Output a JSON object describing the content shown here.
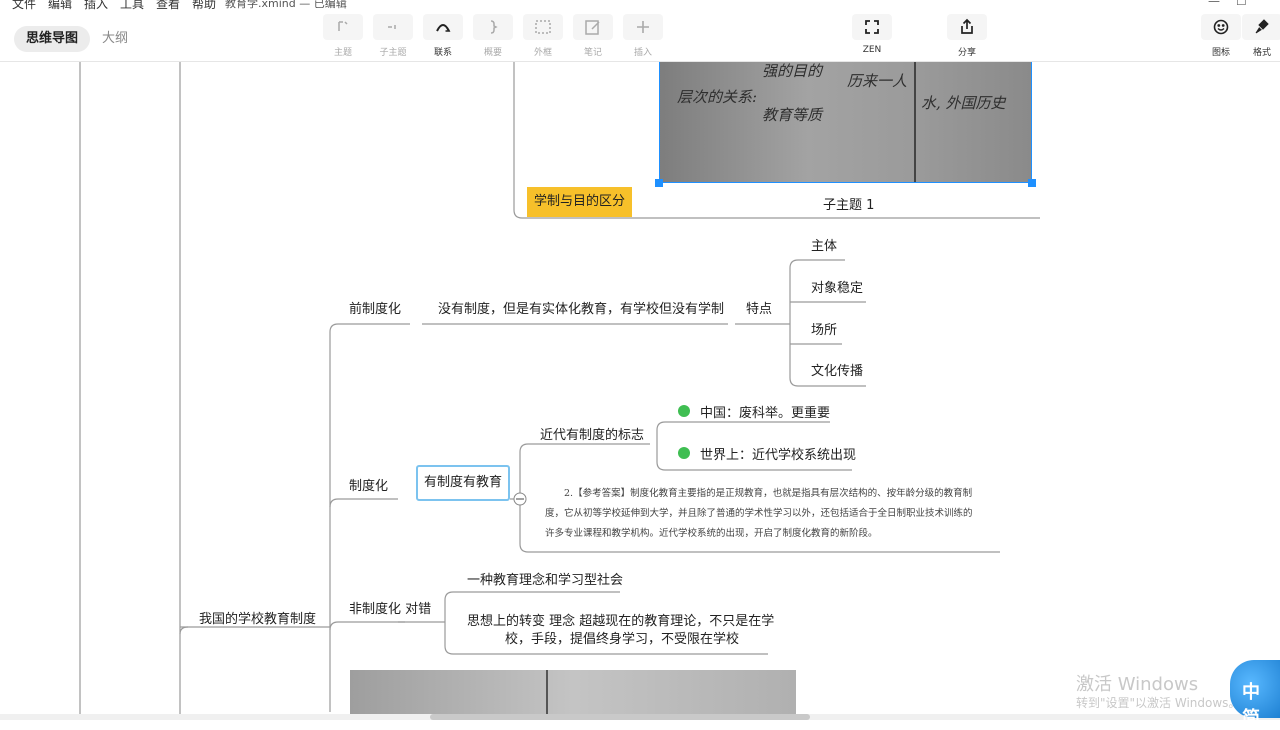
{
  "menu": [
    "文件",
    "编辑",
    "插入",
    "工具",
    "查看",
    "帮助"
  ],
  "window_title": "教育学.xmind — 已编辑",
  "view_tabs": {
    "mindmap": "思维导图",
    "outline": "大纲"
  },
  "toolbar": {
    "topic": "主题",
    "subtopic": "子主题",
    "relation": "联系",
    "summary": "概要",
    "boundary": "外框",
    "note": "笔记",
    "insert": "插入",
    "zen": "ZEN",
    "share": "分享",
    "icon": "图标",
    "format": "格式"
  },
  "map": {
    "root_branch": "我国的学校教育制度",
    "photo1_handwriting": [
      "强的目的",
      "历来一人",
      "层次的关系:",
      "教育等质",
      "水, 外国历史"
    ],
    "tag_xuezhi": "学制与目的区分",
    "subtopic1": "子主题 1",
    "pre": {
      "label": "前制度化",
      "desc": "没有制度，但是有实体化教育，有学校但没有学制",
      "feature": "特点",
      "features": [
        "主体",
        "对象稳定",
        "场所",
        "文化传播"
      ]
    },
    "inst": {
      "label": "制度化",
      "selected": "有制度有教育",
      "mark_title": "近代有制度的标志",
      "marks": [
        "中国：废科举。更重要",
        "世界上：近代学校系统出现"
      ],
      "answer_lines": [
        "2.【参考答案】制度化教育主要指的是正规教育，也就是指具有层次结构的、按年龄分级的教育制",
        "度，它从初等学校延伸到大学，并且除了普通的学术性学习以外，还包括适合于全日制职业技术训练的",
        "许多专业课程和教学机构。近代学校系统的出现，开启了制度化教育的新阶段。"
      ]
    },
    "noninst": {
      "label": "非制度化 对错",
      "items": [
        "一种教育理念和学习型社会"
      ],
      "thought_lines": [
        "思想上的转变  理念  超越现在的教育理论，不只是在学",
        "校，手段，提倡终身学习，不受限在学校"
      ]
    }
  },
  "watermark": {
    "line1": "激活 Windows",
    "line2": "转到\"设置\"以激活 Windows。"
  },
  "ime_label": "中 简",
  "colors": {
    "accent_yellow": "#f7c02a",
    "selection_blue": "#7cc3ef",
    "bullet_green": "#3fbe52"
  }
}
